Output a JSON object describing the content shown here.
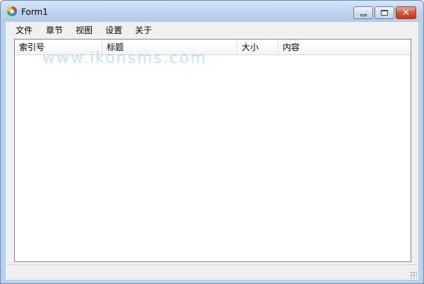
{
  "window": {
    "title": "Form1",
    "controls": {
      "minimize": "minimize",
      "maximize": "maximize",
      "close": "✕"
    }
  },
  "menu": [
    "文件",
    "章节",
    "视图",
    "设置",
    "关于"
  ],
  "listview": {
    "columns": [
      "索引号",
      "标题",
      "大小",
      "内容"
    ],
    "rows": []
  },
  "watermark": "www.ikonsms.com",
  "colors": {
    "titlebar": "#bcd3ec",
    "close_button": "#d2543f",
    "client_bg": "#f0f0f0",
    "list_bg": "#ffffff",
    "watermark": "#78bee6"
  }
}
